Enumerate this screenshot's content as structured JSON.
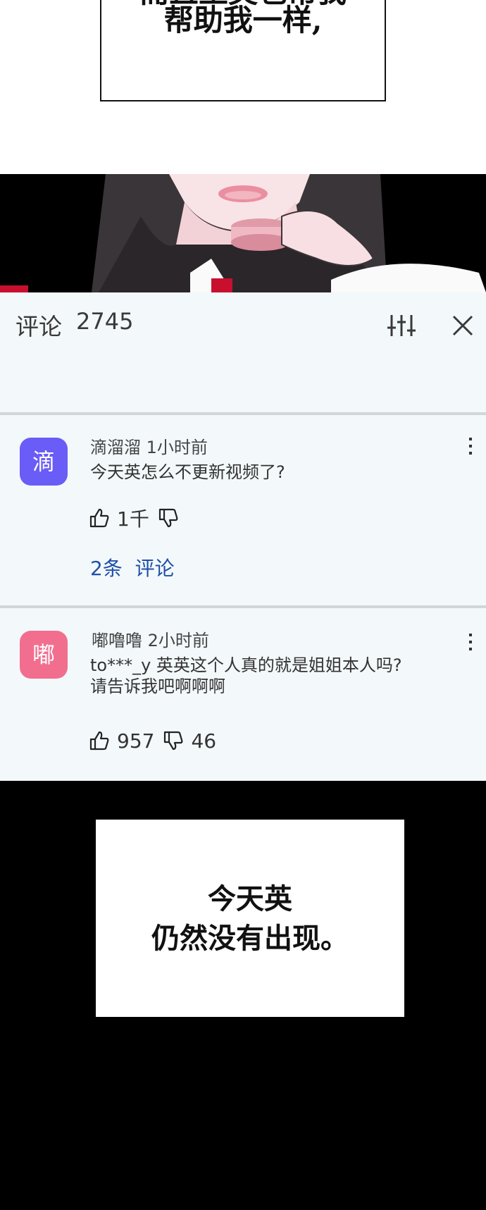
{
  "comic_top": {
    "caption_line1": "而且王英也帮我",
    "caption_line2": "帮助我一样,"
  },
  "comment_sheet": {
    "title": "评论",
    "count": "2745",
    "icons": {
      "filter": "sliders-icon",
      "close": "close-icon"
    },
    "comments": [
      {
        "avatar_char": "滴",
        "avatar_color": "#6a5cf6",
        "author_time": "滴溜溜 1小时前",
        "text_lines": [
          "今天英怎么不更新视频了?"
        ],
        "likes": "1千",
        "dislikes": "",
        "replies_count": "2条",
        "replies_label": "评论"
      },
      {
        "avatar_char": "嘟",
        "avatar_color": "#f26e8f",
        "author_time": "嘟噜噜 2小时前",
        "text_lines": [
          "to***_y 英英这个人真的就是姐姐本人吗?",
          "请告诉我吧啊啊啊"
        ],
        "likes": "957",
        "dislikes": "46"
      }
    ]
  },
  "comic_bottom": {
    "caption_line1": "今天英",
    "caption_line2": "仍然没有出现。"
  },
  "colors": {
    "accent_red": "#c8102e",
    "link_blue": "#1f4fa8",
    "sheet_bg": "#f3f8fb"
  }
}
